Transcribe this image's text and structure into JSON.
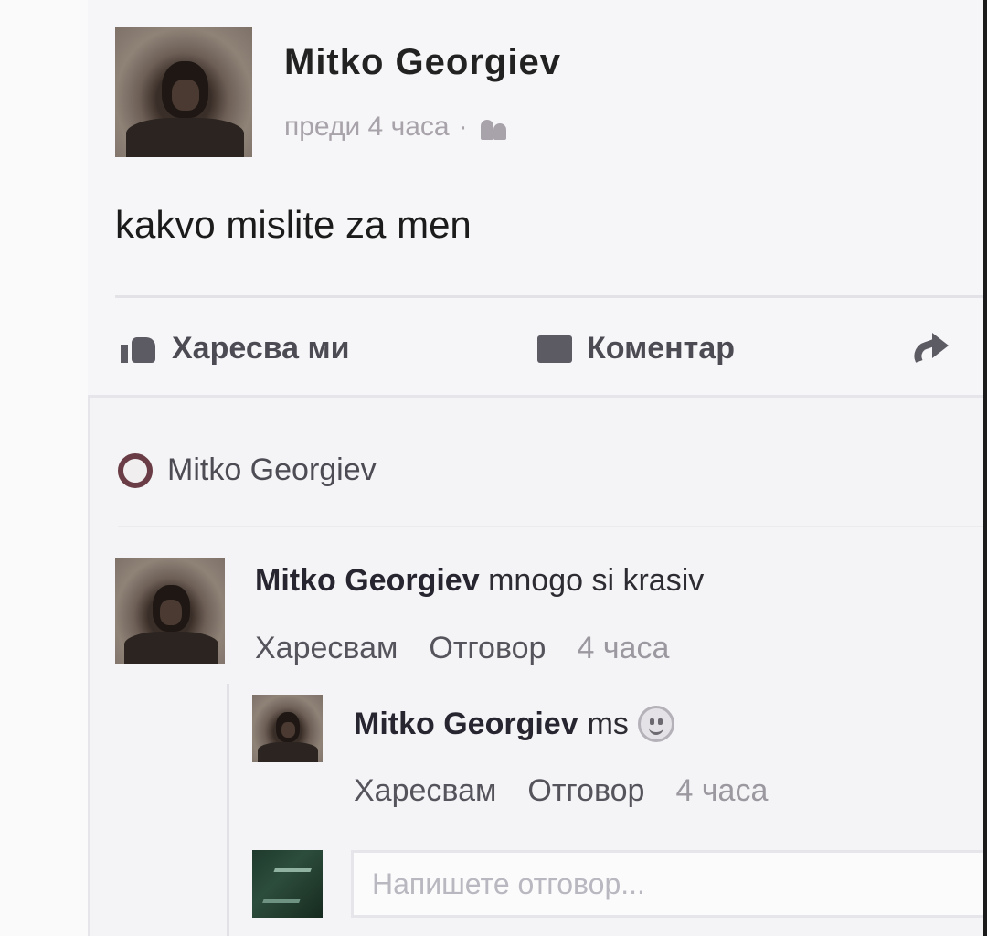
{
  "post": {
    "author": "Mitko Georgiev",
    "time": "преди 4 часа",
    "separator": "·",
    "privacy_icon": "friends-icon",
    "text": "kakvo mislite za men"
  },
  "actions": {
    "like": "Харесва ми",
    "comment": "Коментар"
  },
  "seen_by": "Mitko Georgiev",
  "comments": [
    {
      "author": "Mitko Georgiev",
      "text": "mnogo si krasiv",
      "like": "Харесвам",
      "reply": "Отговор",
      "time": "4 часа"
    },
    {
      "author": "Mitko Georgiev",
      "text": "ms",
      "emoji": "smiley-icon",
      "like": "Харесвам",
      "reply": "Отговор",
      "time": "4 часа"
    }
  ],
  "reply_input": {
    "placeholder": "Напишете отговор..."
  }
}
